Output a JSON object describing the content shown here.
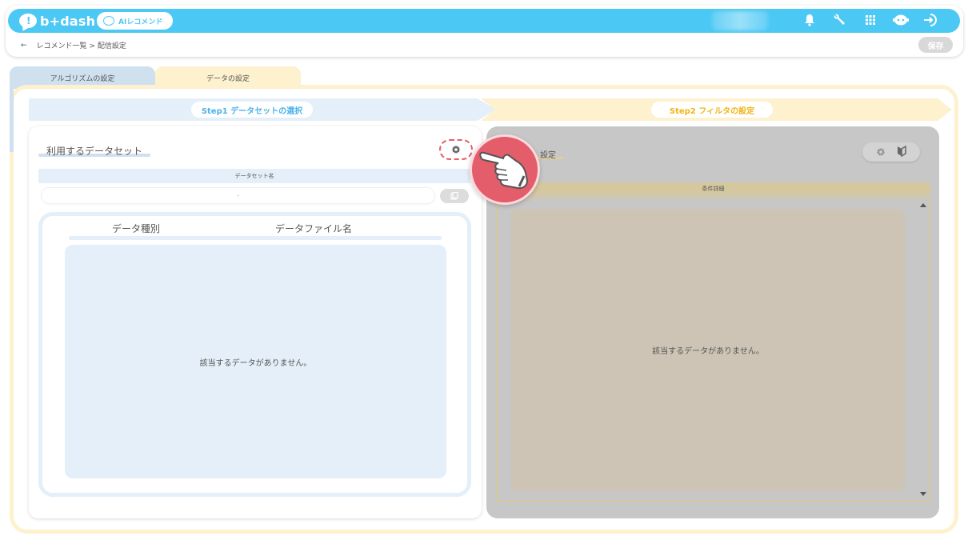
{
  "header": {
    "logo_text": "b+dash",
    "logo_mark": "!",
    "ai_pill_label": "AIレコメンド",
    "icons": [
      "bell-icon",
      "wrench-icon",
      "grid-icon",
      "chat-bot-icon",
      "logout-icon"
    ],
    "accent_color": "#4cc8f5"
  },
  "breadcrumb": {
    "back": "←",
    "parent": "レコメンド一覧",
    "separator": ">",
    "current": "配信設定"
  },
  "save_label": "保存",
  "tabs": [
    {
      "label": "アルゴリズムの設定",
      "active": false
    },
    {
      "label": "データの設定",
      "active": true
    }
  ],
  "steps": [
    {
      "label": "Step1 データセットの選択",
      "color": "#4cb2e8"
    },
    {
      "label": "Step2 フィルタの設定",
      "color": "#f2b316"
    }
  ],
  "left_panel": {
    "title": "利用するデータセット",
    "dataset_name_header": "データセット名",
    "dataset_name_value": "-",
    "columns": [
      "データ種別",
      "データファイル名"
    ],
    "empty_message": "該当するデータがありません。"
  },
  "right_panel": {
    "title_visible": "設定",
    "conditions_header": "条件詳細",
    "empty_message": "該当するデータがありません。"
  }
}
